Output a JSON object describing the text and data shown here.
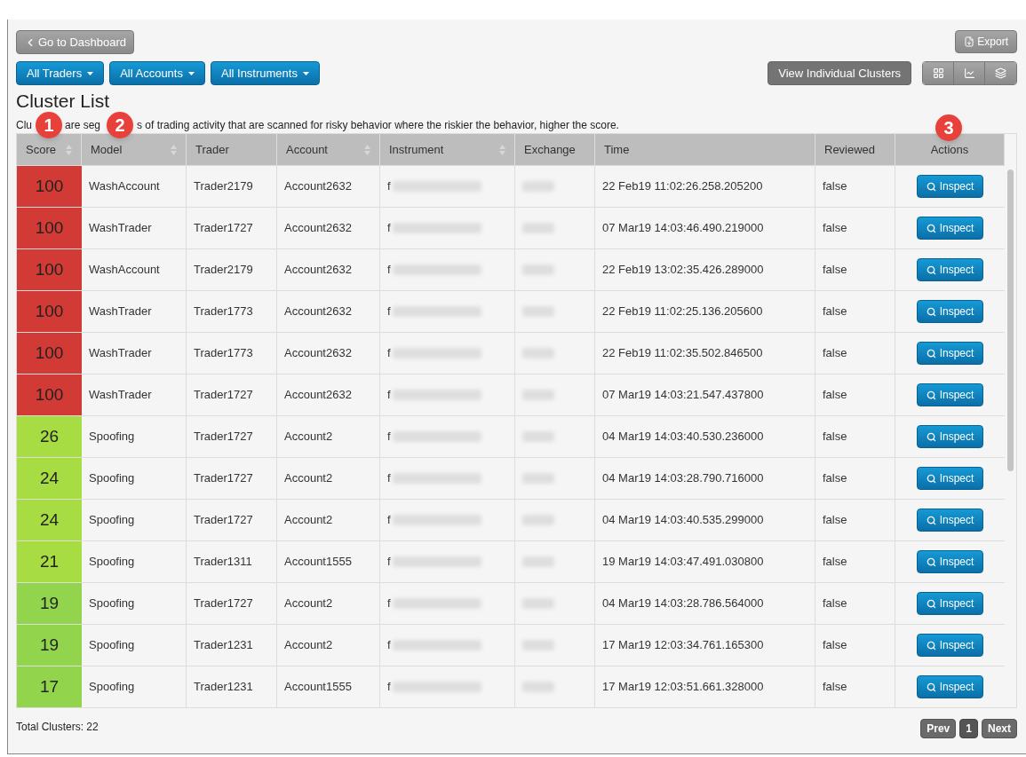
{
  "back_button": "Go to Dashboard",
  "export_button": "Export",
  "filters": [
    "All Traders",
    "All Accounts",
    "All Instruments"
  ],
  "view_clusters_button": "View Individual Clusters",
  "title": "Cluster List",
  "description_fragments": [
    "Clu",
    "are seg",
    "s of trading activity that are scanned for risky behavior where the riskier the behavior, higher the score."
  ],
  "callouts": [
    "1",
    "2",
    "3"
  ],
  "columns": [
    {
      "label": "Score",
      "sortable": true
    },
    {
      "label": "Model",
      "sortable": true
    },
    {
      "label": "Trader",
      "sortable": false
    },
    {
      "label": "Account",
      "sortable": true
    },
    {
      "label": "Instrument",
      "sortable": true
    },
    {
      "label": "Exchange",
      "sortable": false
    },
    {
      "label": "Time",
      "sortable": false
    },
    {
      "label": "Reviewed",
      "sortable": false
    },
    {
      "label": "Actions",
      "sortable": false
    }
  ],
  "rows": [
    {
      "score": "100",
      "color": "#d23a35",
      "model": "WashAccount",
      "trader": "Trader2179",
      "account": "Account2632",
      "instrument": "f",
      "time": "22 Feb19 11:02:26.258.205200",
      "reviewed": "false",
      "action": "Inspect"
    },
    {
      "score": "100",
      "color": "#d23a35",
      "model": "WashTrader",
      "trader": "Trader1727",
      "account": "Account2632",
      "instrument": "f",
      "time": "07 Mar19 14:03:46.490.219000",
      "reviewed": "false",
      "action": "Inspect"
    },
    {
      "score": "100",
      "color": "#d23a35",
      "model": "WashAccount",
      "trader": "Trader2179",
      "account": "Account2632",
      "instrument": "f",
      "time": "22 Feb19 13:02:35.426.289000",
      "reviewed": "false",
      "action": "Inspect"
    },
    {
      "score": "100",
      "color": "#d23a35",
      "model": "WashTrader",
      "trader": "Trader1773",
      "account": "Account2632",
      "instrument": "f",
      "time": "22 Feb19 11:02:25.136.205600",
      "reviewed": "false",
      "action": "Inspect"
    },
    {
      "score": "100",
      "color": "#d23a35",
      "model": "WashTrader",
      "trader": "Trader1773",
      "account": "Account2632",
      "instrument": "f",
      "time": "22 Feb19 11:02:35.502.846500",
      "reviewed": "false",
      "action": "Inspect"
    },
    {
      "score": "100",
      "color": "#d23a35",
      "model": "WashTrader",
      "trader": "Trader1727",
      "account": "Account2632",
      "instrument": "f",
      "time": "07 Mar19 14:03:21.547.437800",
      "reviewed": "false",
      "action": "Inspect"
    },
    {
      "score": "26",
      "color": "#a7dc43",
      "model": "Spoofing",
      "trader": "Trader1727",
      "account": "Account2",
      "instrument": "f",
      "time": "04 Mar19 14:03:40.530.236000",
      "reviewed": "false",
      "action": "Inspect"
    },
    {
      "score": "24",
      "color": "#a7dc43",
      "model": "Spoofing",
      "trader": "Trader1727",
      "account": "Account2",
      "instrument": "f",
      "time": "04 Mar19 14:03:28.790.716000",
      "reviewed": "false",
      "action": "Inspect"
    },
    {
      "score": "24",
      "color": "#a7dc43",
      "model": "Spoofing",
      "trader": "Trader1727",
      "account": "Account2",
      "instrument": "f",
      "time": "04 Mar19 14:03:40.535.299000",
      "reviewed": "false",
      "action": "Inspect"
    },
    {
      "score": "21",
      "color": "#a7dc43",
      "model": "Spoofing",
      "trader": "Trader1311",
      "account": "Account1555",
      "instrument": "f",
      "time": "19 Mar19 14:03:47.491.030800",
      "reviewed": "false",
      "action": "Inspect"
    },
    {
      "score": "19",
      "color": "#92d44c",
      "model": "Spoofing",
      "trader": "Trader1727",
      "account": "Account2",
      "instrument": "f",
      "time": "04 Mar19 14:03:28.786.564000",
      "reviewed": "false",
      "action": "Inspect"
    },
    {
      "score": "19",
      "color": "#92d44c",
      "model": "Spoofing",
      "trader": "Trader1231",
      "account": "Account2",
      "instrument": "f",
      "time": "17 Mar19 12:03:34.761.165300",
      "reviewed": "false",
      "action": "Inspect"
    },
    {
      "score": "17",
      "color": "#92d44c",
      "model": "Spoofing",
      "trader": "Trader1231",
      "account": "Account1555",
      "instrument": "f",
      "time": "17 Mar19 12:03:51.661.328000",
      "reviewed": "false",
      "action": "Inspect"
    }
  ],
  "total": "Total Clusters: 22",
  "pagination": [
    {
      "label": "Prev",
      "selected": false
    },
    {
      "label": "1",
      "selected": true
    },
    {
      "label": "Next",
      "selected": false
    }
  ]
}
